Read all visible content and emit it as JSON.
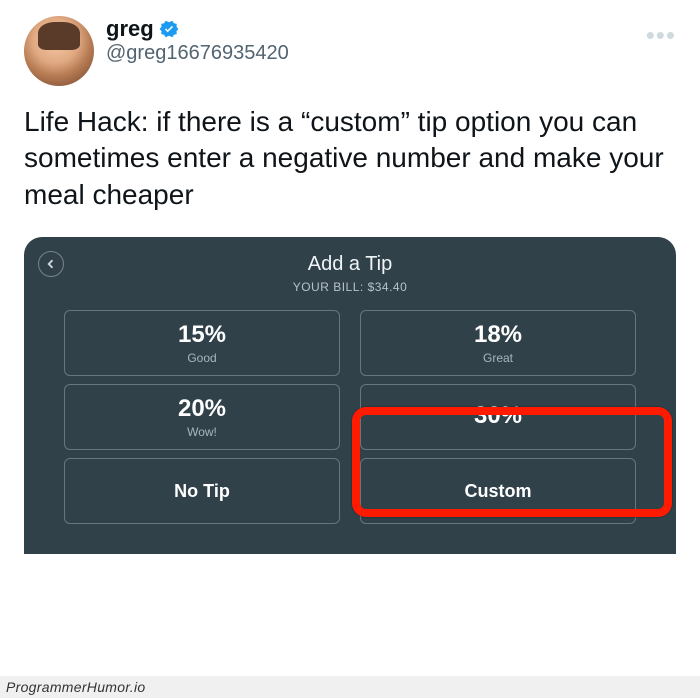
{
  "tweet": {
    "display_name": "greg",
    "handle": "@greg16676935420",
    "more": "•••",
    "text": "Life Hack: if there is a “custom” tip option you can sometimes enter a negative number and make your meal cheaper"
  },
  "tip": {
    "title": "Add a Tip",
    "bill_label": "YOUR BILL: $34.40",
    "cells": [
      {
        "pct": "15%",
        "label": "Good"
      },
      {
        "pct": "18%",
        "label": "Great"
      },
      {
        "pct": "20%",
        "label": "Wow!"
      },
      {
        "pct": "30%",
        "label": ""
      },
      {
        "single": "No Tip"
      },
      {
        "single": "Custom"
      }
    ]
  },
  "watermark": "ProgrammerHumor.io",
  "colors": {
    "verified": "#1d9bf0",
    "highlight": "#ff1a00",
    "tip_bg": "#30414a"
  }
}
